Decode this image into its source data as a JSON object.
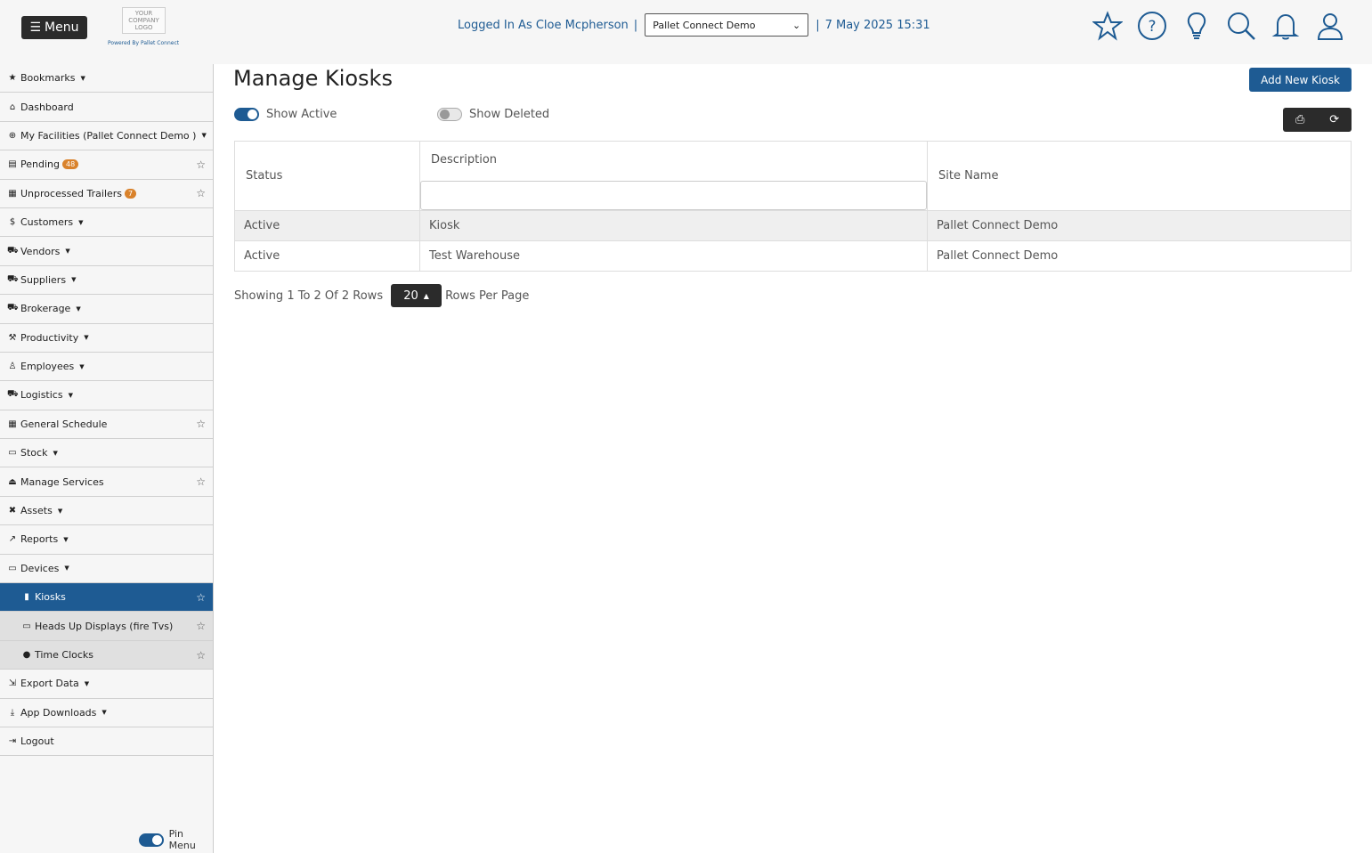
{
  "header": {
    "menu_label": "Menu",
    "logo_lines": [
      "YOUR",
      "COMPANY",
      "LOGO"
    ],
    "powered_by": "Powered By Pallet Connect",
    "logged_in_text": "Logged In As Cloe Mcpherson",
    "separator": "|",
    "facility_selected": "Pallet Connect Demo",
    "datetime": "7 May 2025 15:31",
    "icons": [
      "star-icon",
      "help-icon",
      "idea-icon",
      "search-icon",
      "bell-icon",
      "user-icon"
    ]
  },
  "sidebar": {
    "items": [
      {
        "label": "Bookmarks",
        "icon": "★",
        "caret": true
      },
      {
        "label": "Dashboard",
        "icon": "⌂"
      },
      {
        "label": "My Facilities (Pallet Connect Demo )",
        "icon": "⊕",
        "caret": true
      },
      {
        "label": "Pending",
        "icon": "▤",
        "badge": "48",
        "star": true
      },
      {
        "label": "Unprocessed Trailers",
        "icon": "▦",
        "badge": "7",
        "star": true
      },
      {
        "label": "Customers",
        "icon": "$",
        "caret": true
      },
      {
        "label": "Vendors",
        "icon": "⛟",
        "caret": true
      },
      {
        "label": "Suppliers",
        "icon": "⛟",
        "caret": true
      },
      {
        "label": "Brokerage",
        "icon": "⛟",
        "caret": true
      },
      {
        "label": "Productivity",
        "icon": "⚒",
        "caret": true
      },
      {
        "label": "Employees",
        "icon": "♙",
        "caret": true
      },
      {
        "label": "Logistics",
        "icon": "⛟",
        "caret": true
      },
      {
        "label": "General Schedule",
        "icon": "▦",
        "star": true
      },
      {
        "label": "Stock",
        "icon": "▭",
        "caret": true
      },
      {
        "label": "Manage Services",
        "icon": "⏏",
        "star": true
      },
      {
        "label": "Assets",
        "icon": "✖",
        "caret": true
      },
      {
        "label": "Reports",
        "icon": "↗",
        "caret": true
      },
      {
        "label": "Devices",
        "icon": "▭",
        "caret": true
      },
      {
        "label": "Kiosks",
        "icon": "▮",
        "star": true,
        "active": true
      },
      {
        "label": "Heads Up Displays (fire Tvs)",
        "icon": "▭",
        "star": true,
        "sub": true
      },
      {
        "label": "Time Clocks",
        "icon": "●",
        "star": true,
        "sub": true
      },
      {
        "label": "Export Data",
        "icon": "⇲",
        "caret": true
      },
      {
        "label": "App Downloads",
        "icon": "⤓",
        "caret": true
      },
      {
        "label": "Logout",
        "icon": "⇥"
      }
    ],
    "pin_label": "Pin Menu"
  },
  "main": {
    "title": "Manage Kiosks",
    "add_button": "Add New Kiosk",
    "show_active": "Show Active",
    "show_deleted": "Show Deleted",
    "columns": [
      "Status",
      "Description",
      "Site Name"
    ],
    "rows": [
      [
        "Active",
        "Kiosk",
        "Pallet Connect Demo"
      ],
      [
        "Active",
        "Test Warehouse",
        "Pallet Connect Demo"
      ]
    ],
    "pager_text": "Showing 1 To 2 Of 2 Rows",
    "rows_per_page_value": "20",
    "rows_per_page_label": "Rows Per Page"
  }
}
